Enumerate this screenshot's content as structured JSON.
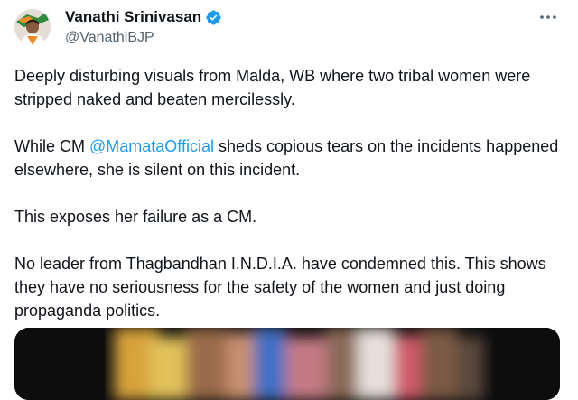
{
  "author": {
    "display_name": "Vanathi Srinivasan",
    "handle": "@VanathiBJP",
    "verified_icon": "verified-badge-icon",
    "avatar_icon": "profile-photo"
  },
  "actions": {
    "more_icon": "more-options-icon"
  },
  "tweet": {
    "p1": "Deeply disturbing visuals from Malda, WB where two tribal women were stripped naked and beaten mercilessly.",
    "p2_before": "While CM ",
    "p2_mention": "@MamataOfficial",
    "p2_after": " sheds copious tears on the incidents happened elsewhere, she is silent on this incident.",
    "p3": "This exposes her failure as a CM.",
    "p4": "No leader from Thagbandhan I.N.D.I.A. have condemned this. This shows they have no seriousness for the safety of the women and just doing propaganda politics."
  },
  "media": {
    "type": "blurred-video-thumbnail"
  },
  "colors": {
    "text": "#0f1419",
    "secondary": "#536471",
    "link": "#1d9bf0",
    "verified": "#1d9bf0"
  }
}
